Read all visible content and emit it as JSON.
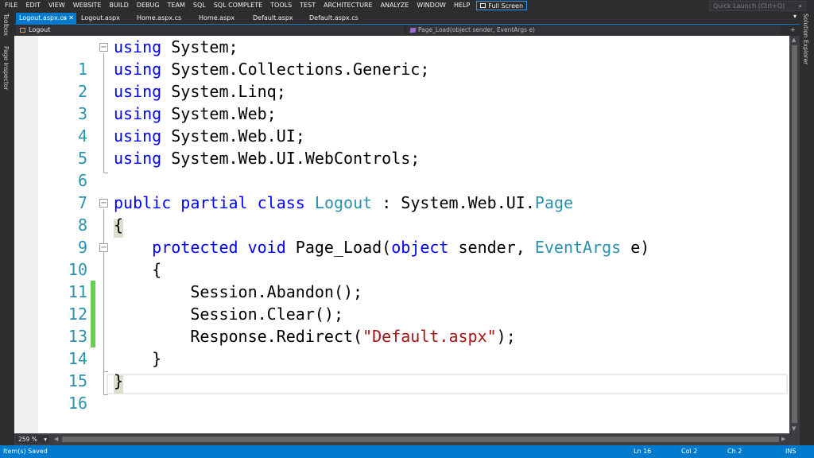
{
  "menu": [
    "FILE",
    "EDIT",
    "VIEW",
    "WEBSITE",
    "BUILD",
    "DEBUG",
    "TEAM",
    "SQL",
    "SQL COMPLETE",
    "TOOLS",
    "TEST",
    "ARCHITECTURE",
    "ANALYZE",
    "WINDOW",
    "HELP"
  ],
  "fullscreen_label": "Full Screen",
  "quick_launch": {
    "placeholder": "Quick Launch (Ctrl+Q)"
  },
  "left_strip": {
    "toolbox": "Toolbox",
    "page_inspector": "Page Inspector"
  },
  "right_strip": {
    "solution_explorer": "Solution Explorer"
  },
  "tabs": [
    {
      "label": "Logout.aspx.cs",
      "active": true
    },
    {
      "label": "Logout.aspx",
      "active": false
    },
    {
      "label": "Home.aspx.cs",
      "active": false
    },
    {
      "label": "Home.aspx",
      "active": false
    },
    {
      "label": "Default.aspx",
      "active": false
    },
    {
      "label": "Default.aspx.cs",
      "active": false
    }
  ],
  "navbar": {
    "class_scope": "Logout",
    "member_scope": "Page_Load(object sender, EventArgs e)"
  },
  "code": {
    "line_numbers": [
      "1",
      "2",
      "3",
      "4",
      "5",
      "6",
      "7",
      "8",
      "9",
      "10",
      "11",
      "12",
      "13",
      "14",
      "15",
      "16"
    ],
    "l1": {
      "kw": "using",
      "rest": " System;"
    },
    "l2": {
      "kw": "using",
      "rest": " System.Collections.Generic;"
    },
    "l3": {
      "kw": "using",
      "rest": " System.Linq;"
    },
    "l4": {
      "kw": "using",
      "rest": " System.Web;"
    },
    "l5": {
      "kw": "using",
      "rest": " System.Web.UI;"
    },
    "l6": {
      "kw": "using",
      "rest": " System.Web.UI.WebControls;"
    },
    "l8": {
      "kw1": "public",
      "kw2": "partial",
      "kw3": "class",
      "type1": "Logout",
      "mid": " : System.Web.UI.",
      "type2": "Page"
    },
    "l9": {
      "text": "{"
    },
    "l10": {
      "indent": "    ",
      "kw1": "protected",
      "kw2": "void",
      "name": " Page_Load(",
      "kw3": "object",
      "mid": " sender, ",
      "type1": "EventArgs",
      "end": " e)"
    },
    "l11": {
      "text": "    {"
    },
    "l12": {
      "text": "        Session.Abandon();"
    },
    "l13": {
      "text": "        Session.Clear();"
    },
    "l14": {
      "pre": "        Response.Redirect(",
      "str": "\"Default.aspx\"",
      "post": ");"
    },
    "l15": {
      "text": "    }"
    },
    "l16": {
      "text": "}"
    }
  },
  "zoom": "259 %",
  "status": {
    "message": "Item(s) Saved",
    "ln": "Ln 16",
    "col": "Col 2",
    "ch": "Ch 2",
    "mode": "INS"
  },
  "colors": {
    "accent": "#007acc",
    "keyword": "#0000ff",
    "type": "#2b91af",
    "string": "#a31515",
    "changed": "#6cce55"
  }
}
